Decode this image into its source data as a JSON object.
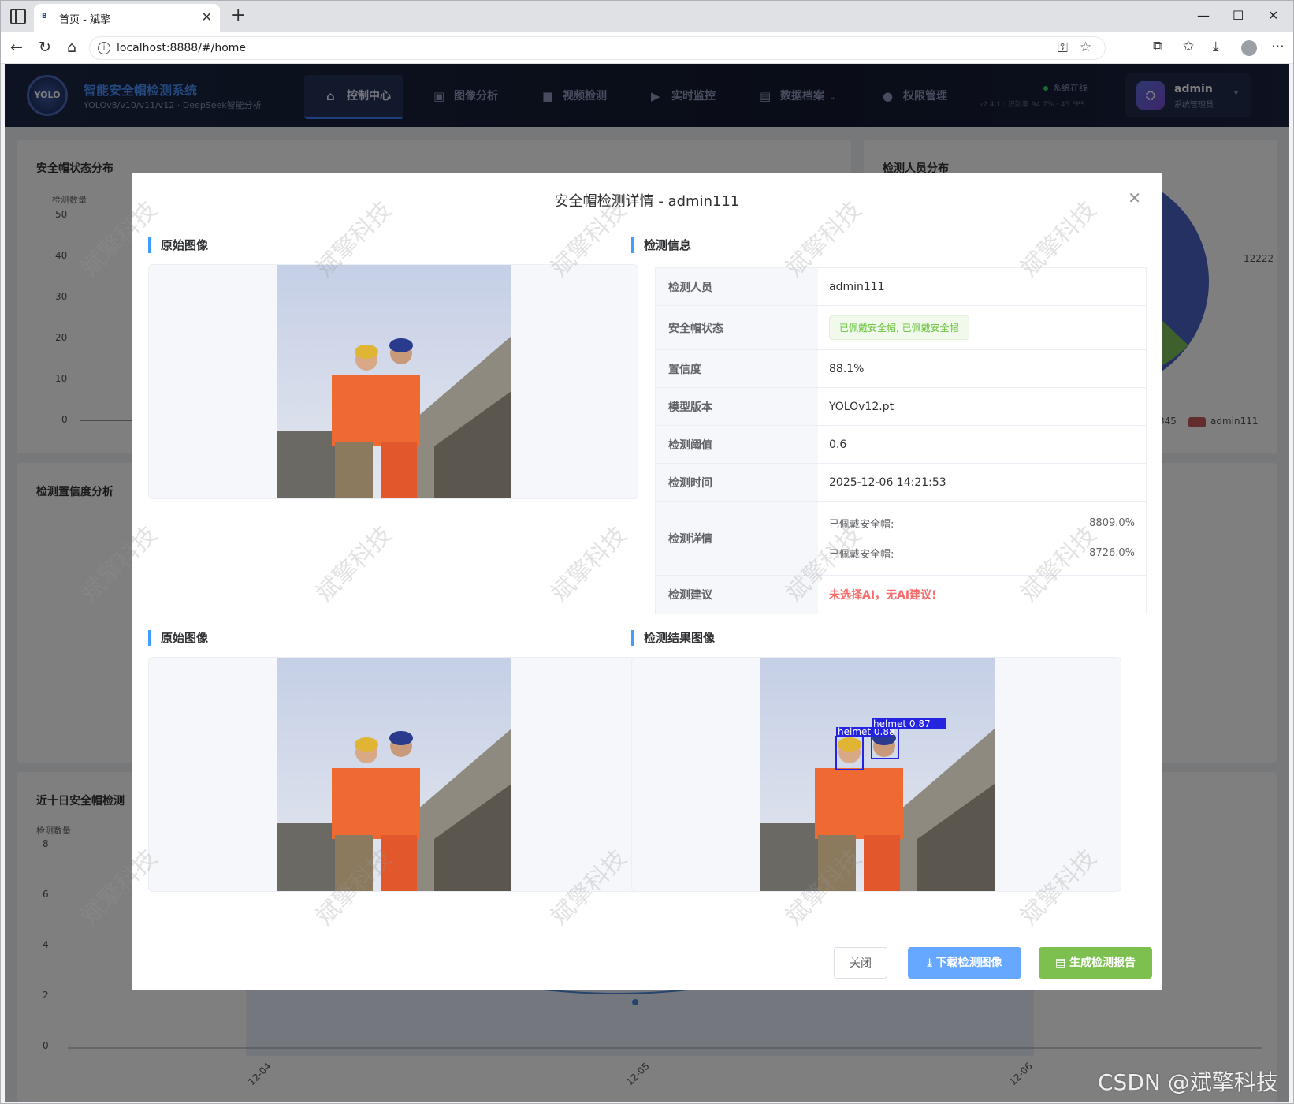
{
  "browser": {
    "tab_title": "首页 - 斌擎",
    "tab_favicon": "B",
    "url": "localhost:8888/#/home"
  },
  "app": {
    "logo_text": "YOLO",
    "title": "智能安全帽检测系统",
    "subtitle": "YOLOv8/v10/v11/v12 · DeepSeek智能分析",
    "nav": [
      {
        "label": "控制中心",
        "icon": "home-icon",
        "active": true
      },
      {
        "label": "图像分析",
        "icon": "image-icon",
        "active": false
      },
      {
        "label": "视频检测",
        "icon": "video-icon",
        "active": false
      },
      {
        "label": "实时监控",
        "icon": "camera-icon",
        "active": false
      },
      {
        "label": "数据档案",
        "icon": "document-icon",
        "active": false
      },
      {
        "label": "权限管理",
        "icon": "user-icon",
        "active": false
      }
    ],
    "status_online": "系统在线",
    "version_line": "v2.4.1 · 识别率 94.7% · 45 FPS",
    "user": {
      "name": "admin",
      "role": "系统管理员"
    }
  },
  "dashboard": {
    "panel1": {
      "title": "安全帽状态分布",
      "ylabel": "检测数量",
      "yticks": [
        "50",
        "40",
        "30",
        "20",
        "10",
        "0"
      ]
    },
    "panel2": {
      "title": "检测人员分布",
      "legend_label": "admin111",
      "slice_label": "12222",
      "legend_partial": "345"
    },
    "panel3": {
      "title": "检测置信度分析"
    },
    "panel4": {
      "title": "近十日安全帽检测",
      "ylabel": "检测数量",
      "yticks": [
        "8",
        "6",
        "4",
        "2",
        "0"
      ],
      "xticks": [
        "12-04",
        "12-05",
        "12-06"
      ]
    }
  },
  "dialog": {
    "title": "安全帽检测详情 - admin111",
    "section_original": "原始图像",
    "section_info": "检测信息",
    "section_original2": "原始图像",
    "section_result": "检测结果图像",
    "info": {
      "person_label": "检测人员",
      "person_value": "admin111",
      "status_label": "安全帽状态",
      "status_value": "已佩戴安全帽, 已佩戴安全帽",
      "conf_label": "置信度",
      "conf_value": "88.1%",
      "model_label": "模型版本",
      "model_value": "YOLOv12.pt",
      "thresh_label": "检测阈值",
      "thresh_value": "0.6",
      "time_label": "检测时间",
      "time_value": "2025-12-06 14:21:53",
      "detail_label": "检测详情",
      "details": [
        {
          "name": "已佩戴安全帽:",
          "value": "8809.0%"
        },
        {
          "name": "已佩戴安全帽:",
          "value": "8726.0%"
        }
      ],
      "advice_label": "检测建议",
      "advice_value": "未选择AI，无AI建议!"
    },
    "boxes": [
      {
        "label": "helmet 0.88"
      },
      {
        "label": "helmet 0.87"
      }
    ],
    "buttons": {
      "close": "关闭",
      "download": "下载检测图像",
      "report": "生成检测报告"
    }
  },
  "watermark": "斌擎科技",
  "footer_mark": "CSDN @斌擎科技",
  "colors": {
    "primary": "#409eff",
    "success": "#67c23a",
    "danger": "#f56c6c",
    "appbar": "#131a2e"
  }
}
